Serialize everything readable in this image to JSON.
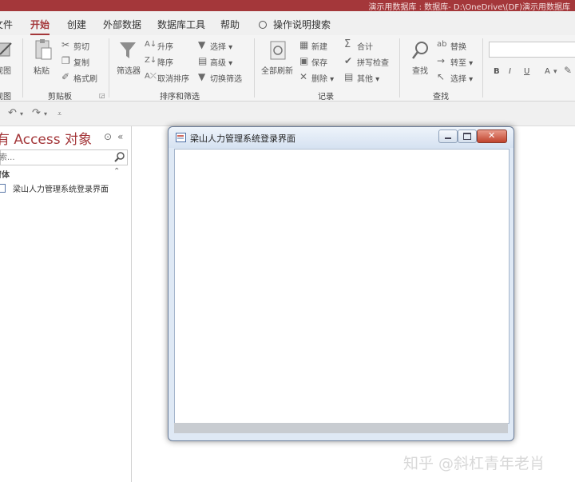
{
  "titlebar": {
    "text": "演示用数据库 : 数据库- D:\\OneDrive\\(DF)演示用数据库"
  },
  "menu": {
    "items": [
      "文件",
      "开始",
      "创建",
      "外部数据",
      "数据库工具",
      "帮助",
      "操作说明搜索"
    ],
    "active_index": 1
  },
  "ribbon": {
    "view": {
      "label": "视图",
      "group": "视图"
    },
    "clipboard": {
      "paste": "粘贴",
      "cut": "剪切",
      "copy": "复制",
      "format_painter": "格式刷",
      "group": "剪贴板"
    },
    "sort_filter": {
      "filter": "筛选器",
      "asc": "升序",
      "desc": "降序",
      "clear_sort": "取消排序",
      "selection": "选择",
      "advanced": "高级",
      "toggle_filter": "切换筛选",
      "group": "排序和筛选"
    },
    "records": {
      "refresh_all": "全部刷新",
      "new": "新建",
      "save": "保存",
      "delete": "删除",
      "totals": "合计",
      "spelling": "拼写检查",
      "more": "其他",
      "group": "记录"
    },
    "find": {
      "find": "查找",
      "replace": "替换",
      "goto": "转至",
      "select": "选择",
      "group": "查找"
    },
    "text_format": {
      "bold": "B",
      "italic": "I",
      "underline": "U",
      "font_color": "A"
    }
  },
  "nav": {
    "title": "所有 Access 对象",
    "search_placeholder": "搜索...",
    "section": "窗体",
    "items": [
      "梁山人力管理系统登录界面"
    ]
  },
  "form_window": {
    "title": "梁山人力管理系统登录界面"
  },
  "watermark": "知乎 @斜杠青年老肖"
}
